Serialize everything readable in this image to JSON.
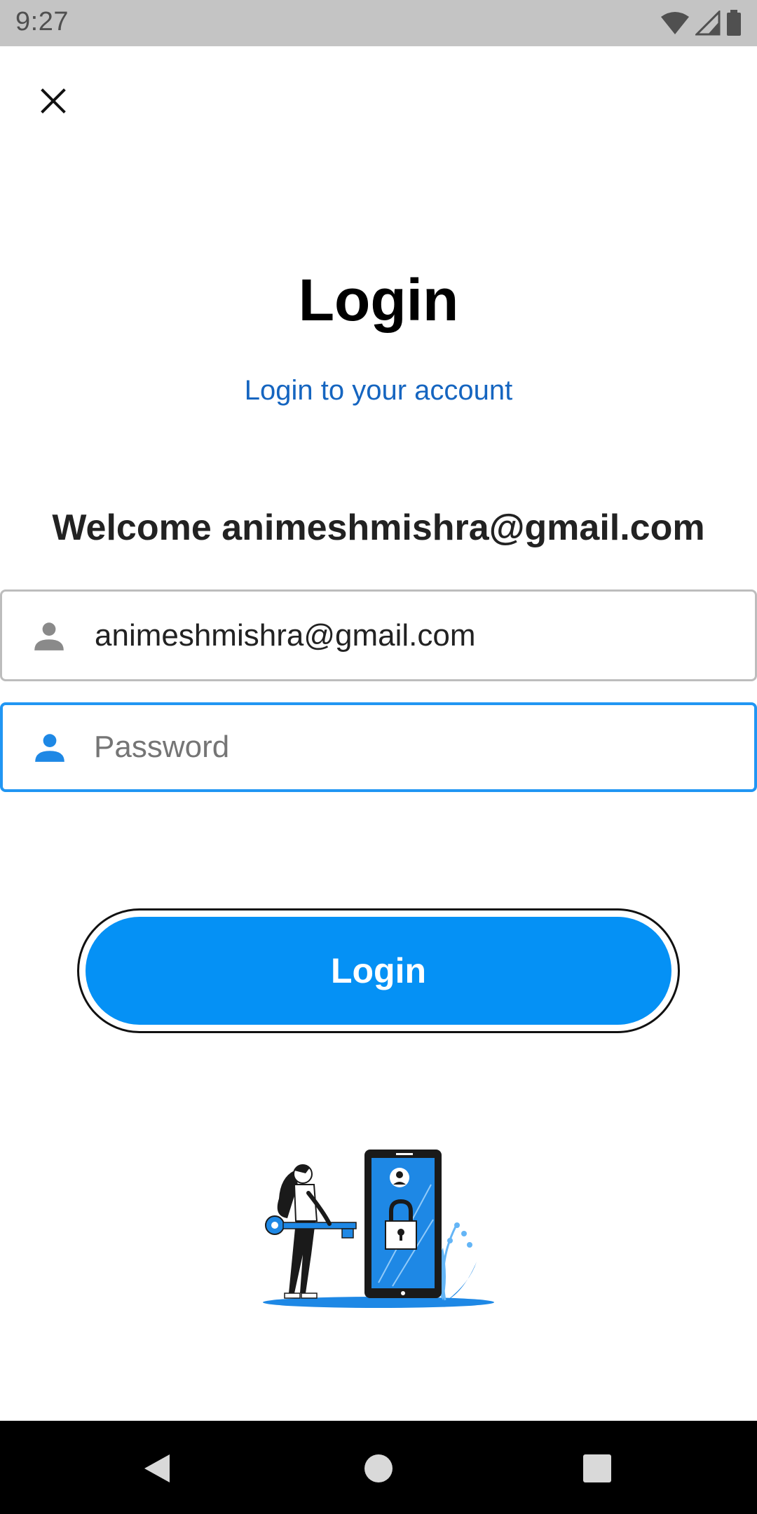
{
  "status_bar": {
    "time": "9:27",
    "icons": [
      "wifi-icon",
      "cell-signal-icon",
      "battery-icon"
    ]
  },
  "header": {
    "close_icon": "close-icon"
  },
  "title": "Login",
  "subtitle": "Login to your account",
  "welcome": "Welcome animeshmishra@gmail.com",
  "email_field": {
    "icon": "person-icon",
    "value": "animeshmishra@gmail.com"
  },
  "password_field": {
    "icon": "person-icon",
    "placeholder": "Password",
    "value": ""
  },
  "login_button": {
    "label": "Login"
  },
  "colors": {
    "accent": "#0591f5",
    "focus_border": "#2196f3",
    "subtitle": "#1565c0",
    "status_bar": "#c4c4c4",
    "nav_bar": "#000000"
  },
  "nav_bar": {
    "buttons": [
      "back-icon",
      "home-icon",
      "recents-icon"
    ]
  }
}
